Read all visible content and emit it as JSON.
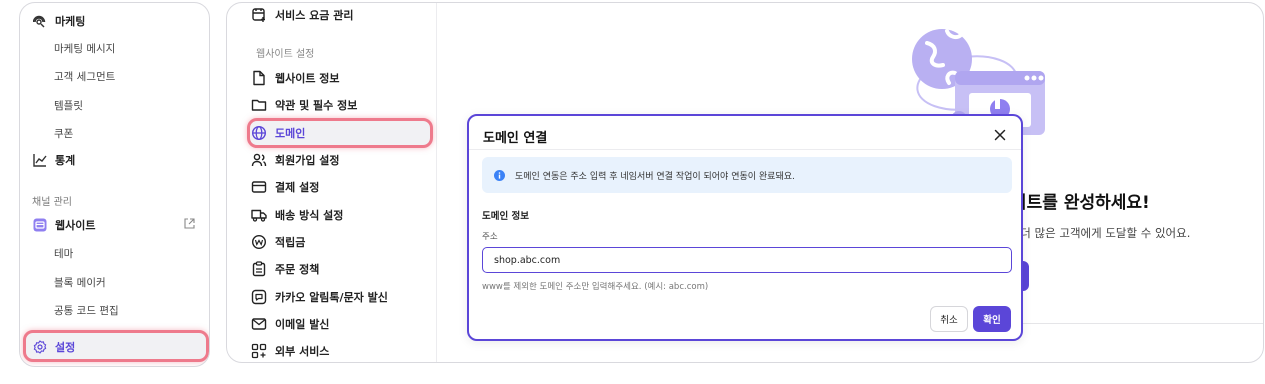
{
  "sidebar": {
    "marketing": "마케팅",
    "marketing_message": "마케팅 메시지",
    "customer_segment": "고객 세그먼트",
    "template": "템플릿",
    "coupon": "쿠폰",
    "stats": "통계",
    "channel_section": "채널 관리",
    "website": "웹사이트",
    "theme": "테마",
    "block_maker": "블록 메이커",
    "common_code": "공통 코드 편집",
    "settings": "설정"
  },
  "settings_menu": {
    "service_fee": "서비스 요금 관리",
    "website_section": "웹사이트 설정",
    "website_info": "웹사이트 정보",
    "terms": "약관 및 필수 정보",
    "domain": "도메인",
    "signup": "회원가입 설정",
    "payment": "결제 설정",
    "shipping": "배송 방식 설정",
    "points": "적립금",
    "order_policy": "주문 정책",
    "kakao": "카카오 알림톡/문자 발신",
    "email": "이메일 발신",
    "external": "외부 서비스"
  },
  "background": {
    "heading": "이트를 완성하세요!",
    "subtext": ", 더 많은 고객에게 도달할 수 있어요."
  },
  "modal": {
    "title": "도메인 연결",
    "info": "도메인 연동은 주소 입력 후 네임서버 연결 작업이 되어야 연동이 완료돼요.",
    "section_label": "도메인 정보",
    "field_label": "주소",
    "address_value": "shop.abc.com",
    "helper": "www를 제외한 도메인 주소만 입력해주세요. (예시: abc.com)",
    "cancel": "취소",
    "confirm": "확인"
  },
  "colors": {
    "accent": "#5b46d8",
    "highlight": "#ee7a8c",
    "info_bg": "#e8f2fd",
    "illustration": "#b9b0f2"
  },
  "icons": {
    "marketing": "broadcast-icon",
    "stats": "chart-line-icon",
    "website": "storefront-icon",
    "external_link": "external-link-icon",
    "settings": "gear-icon",
    "info": "info-circle-icon",
    "close": "close-icon"
  }
}
